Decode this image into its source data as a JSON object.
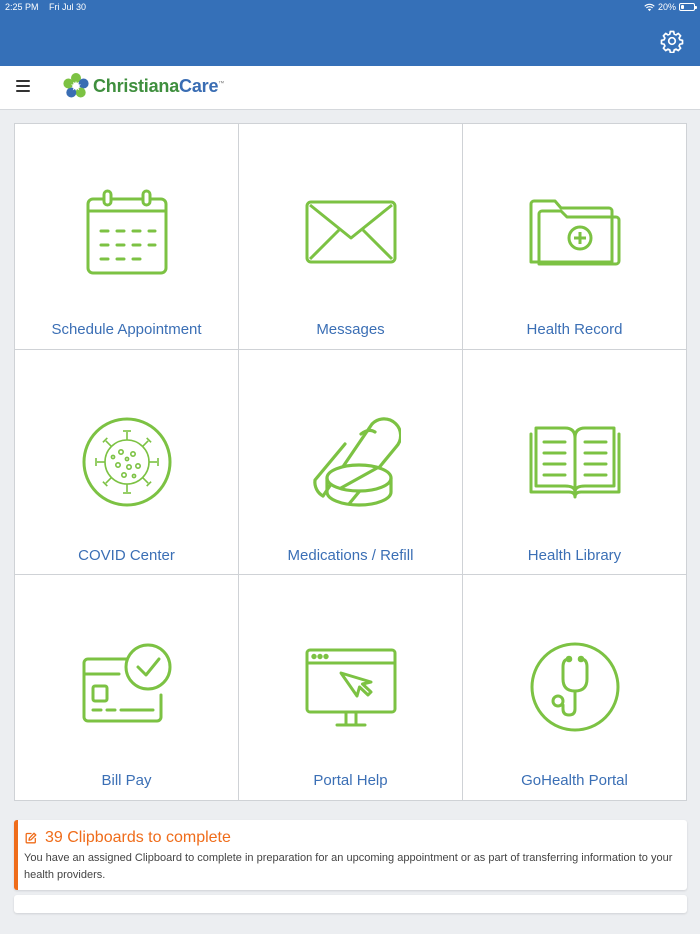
{
  "status_bar": {
    "time": "2:25 PM",
    "date": "Fri Jul 30",
    "battery": "20%",
    "battery_level": 0.2
  },
  "header": {
    "brand_name_1": "Christiana",
    "brand_name_2": "Care",
    "trademark": "™"
  },
  "colors": {
    "primary": "#3570b8",
    "icon_green": "#7cc243",
    "label_blue": "#3b6fb5",
    "alert_orange": "#ef6c1a"
  },
  "tiles": [
    {
      "label": "Schedule Appointment",
      "icon": "calendar-icon"
    },
    {
      "label": "Messages",
      "icon": "envelope-icon"
    },
    {
      "label": "Health Record",
      "icon": "medical-folder-icon"
    },
    {
      "label": "COVID Center",
      "icon": "virus-icon"
    },
    {
      "label": "Medications / Refill",
      "icon": "pills-icon"
    },
    {
      "label": "Health Library",
      "icon": "open-book-icon"
    },
    {
      "label": "Bill Pay",
      "icon": "credit-card-check-icon"
    },
    {
      "label": "Portal Help",
      "icon": "monitor-cursor-icon"
    },
    {
      "label": "GoHealth Portal",
      "icon": "stethoscope-icon"
    }
  ],
  "clipboard_alert": {
    "title": "39 Clipboards to complete",
    "message": "You have an assigned Clipboard to complete in preparation for an upcoming appointment or as part of transferring information to your health providers."
  }
}
